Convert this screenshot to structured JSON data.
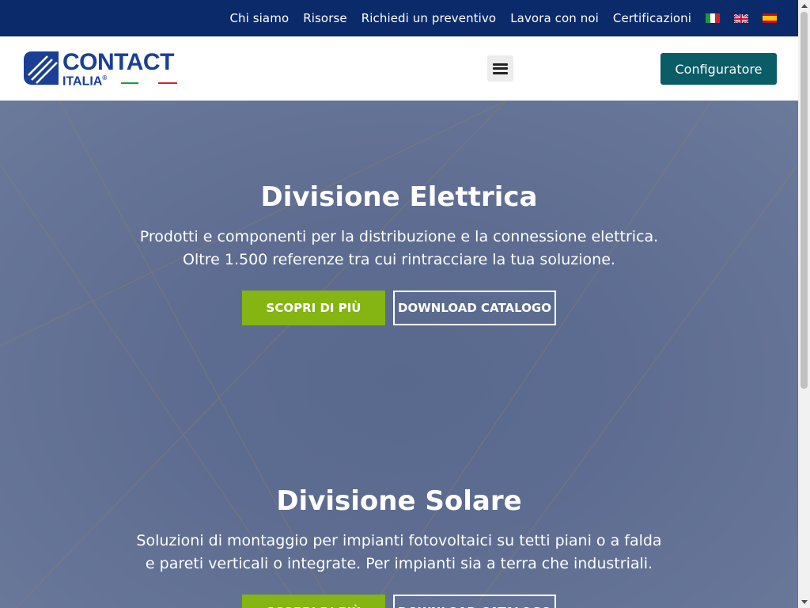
{
  "topbar": {
    "links": [
      "Chi siamo",
      "Risorse",
      "Richiedi un preventivo",
      "Lavora con noi",
      "Certificazioni"
    ],
    "flags": [
      "italian-flag",
      "english-flag",
      "spanish-flag"
    ]
  },
  "header": {
    "logo_main": "CONTACT",
    "logo_sub": "ITALIA",
    "logo_reg": "®",
    "configurator_label": "Configuratore"
  },
  "divisions": [
    {
      "title": "Divisione Elettrica",
      "desc_line1": "Prodotti e componenti per la distribuzione e la connessione elettrica.",
      "desc_line2": "Oltre 1.500 referenze tra cui rintracciare la tua soluzione.",
      "primary_label": "SCOPRI DI PIÙ",
      "secondary_label": "DOWNLOAD CATALOGO"
    },
    {
      "title": "Divisione Solare",
      "desc_line1": "Soluzioni di montaggio per impianti fotovoltaici su tetti piani o a falda",
      "desc_line2": "e pareti verticali o integrate. Per impianti sia a terra che industriali.",
      "primary_label": "SCOPRI DI PIÙ",
      "secondary_label": "DOWNLOAD CATALOGO"
    }
  ],
  "colors": {
    "topbar": "#0b2a6a",
    "brand_blue": "#1a3f95",
    "configurator": "#0a5c67",
    "green_button": "#84b512",
    "hero": "#5d6c90"
  }
}
